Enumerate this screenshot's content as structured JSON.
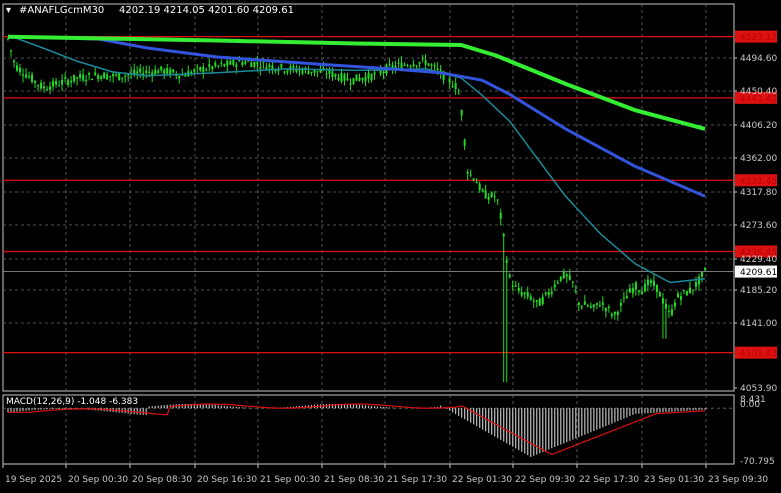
{
  "colors": {
    "background": "#000000",
    "grid": "#6b6b6b",
    "axis": "#c8c8c8",
    "candle": "#22dd22",
    "ma_slow": "#33ee33",
    "ma_mid": "#3355dd",
    "ma_fast": "#1a8a9a",
    "level_line": "#dd1111",
    "level_label_bg": "#dd1111",
    "level_label_text": "#bb0000",
    "current_label_bg": "#ffffff",
    "current_label_text": "#000000",
    "macd_hist": "#c0c0c0",
    "macd_signal": "#dd1111"
  },
  "header": {
    "symbol_info": "#ANAFLGcmM30",
    "ohlc": "4202.19 4214.05 4201.60 4209.61"
  },
  "chart_data": [
    {
      "type": "candlestick",
      "title": "",
      "y_ticks": [
        "4494.60",
        "4450.40",
        "4406.20",
        "4362.00",
        "4317.80",
        "4273.60",
        "4229.40",
        "4185.20",
        "4141.00",
        "4053.90"
      ],
      "x_ticks": [
        "19 Sep 2025",
        "20 Sep 00:30",
        "20 Sep 08:30",
        "20 Sep 16:30",
        "21 Sep 00:30",
        "21 Sep 08:30",
        "21 Sep 17:30",
        "22 Sep 01:30",
        "22 Sep 09:30",
        "22 Sep 17:30",
        "23 Sep 01:30",
        "23 Sep 09:30"
      ],
      "price_path": [
        [
          0,
          4520
        ],
        [
          0.01,
          4485
        ],
        [
          0.03,
          4470
        ],
        [
          0.05,
          4455
        ],
        [
          0.07,
          4460
        ],
        [
          0.1,
          4468
        ],
        [
          0.13,
          4472
        ],
        [
          0.16,
          4470
        ],
        [
          0.19,
          4475
        ],
        [
          0.22,
          4478
        ],
        [
          0.25,
          4472
        ],
        [
          0.28,
          4480
        ],
        [
          0.31,
          4485
        ],
        [
          0.34,
          4490
        ],
        [
          0.37,
          4485
        ],
        [
          0.4,
          4480
        ],
        [
          0.43,
          4478
        ],
        [
          0.46,
          4475
        ],
        [
          0.49,
          4465
        ],
        [
          0.52,
          4470
        ],
        [
          0.55,
          4482
        ],
        [
          0.58,
          4488
        ],
        [
          0.6,
          4490
        ],
        [
          0.62,
          4475
        ],
        [
          0.645,
          4455
        ],
        [
          0.65,
          4430
        ],
        [
          0.66,
          4340
        ],
        [
          0.67,
          4335
        ],
        [
          0.68,
          4315
        ],
        [
          0.69,
          4310
        ],
        [
          0.7,
          4310
        ],
        [
          0.705,
          4295
        ],
        [
          0.715,
          4230
        ],
        [
          0.72,
          4200
        ],
        [
          0.73,
          4185
        ],
        [
          0.74,
          4180
        ],
        [
          0.75,
          4175
        ],
        [
          0.76,
          4165
        ],
        [
          0.77,
          4175
        ],
        [
          0.78,
          4185
        ],
        [
          0.79,
          4200
        ],
        [
          0.8,
          4205
        ],
        [
          0.81,
          4195
        ],
        [
          0.82,
          4165
        ],
        [
          0.83,
          4165
        ],
        [
          0.84,
          4160
        ],
        [
          0.85,
          4168
        ],
        [
          0.86,
          4160
        ],
        [
          0.87,
          4150
        ],
        [
          0.88,
          4165
        ],
        [
          0.89,
          4180
        ],
        [
          0.9,
          4190
        ],
        [
          0.91,
          4185
        ],
        [
          0.92,
          4195
        ],
        [
          0.93,
          4190
        ],
        [
          0.94,
          4170
        ],
        [
          0.95,
          4150
        ],
        [
          0.96,
          4175
        ],
        [
          0.97,
          4180
        ],
        [
          0.98,
          4185
        ],
        [
          0.99,
          4195
        ],
        [
          1.0,
          4209.61
        ]
      ],
      "ma_slow": [
        [
          0,
          4523
        ],
        [
          0.3,
          4518
        ],
        [
          0.5,
          4514
        ],
        [
          0.65,
          4512
        ],
        [
          0.7,
          4498
        ],
        [
          0.8,
          4460
        ],
        [
          0.9,
          4425
        ],
        [
          1.0,
          4400
        ]
      ],
      "ma_mid": [
        [
          0,
          4523
        ],
        [
          0.13,
          4520
        ],
        [
          0.2,
          4508
        ],
        [
          0.3,
          4496
        ],
        [
          0.45,
          4486
        ],
        [
          0.55,
          4480
        ],
        [
          0.62,
          4475
        ],
        [
          0.68,
          4465
        ],
        [
          0.72,
          4446
        ],
        [
          0.8,
          4400
        ],
        [
          0.9,
          4350
        ],
        [
          1.0,
          4310
        ]
      ],
      "ma_fast": [
        [
          0,
          4525
        ],
        [
          0.05,
          4508
        ],
        [
          0.1,
          4490
        ],
        [
          0.15,
          4476
        ],
        [
          0.2,
          4471
        ],
        [
          0.3,
          4475
        ],
        [
          0.4,
          4480
        ],
        [
          0.5,
          4478
        ],
        [
          0.6,
          4480
        ],
        [
          0.65,
          4468
        ],
        [
          0.68,
          4445
        ],
        [
          0.72,
          4410
        ],
        [
          0.76,
          4360
        ],
        [
          0.8,
          4310
        ],
        [
          0.85,
          4260
        ],
        [
          0.9,
          4220
        ],
        [
          0.95,
          4195
        ],
        [
          1.0,
          4200
        ]
      ],
      "levels": [
        {
          "label": "4523.17",
          "value": 4523.17
        },
        {
          "label": "4441.42",
          "value": 4441.42
        },
        {
          "label": "4331.45",
          "value": 4331.45
        },
        {
          "label": "4236.45",
          "value": 4236.45
        },
        {
          "label": "4101.43",
          "value": 4101.43
        }
      ],
      "current_price": {
        "label": "4209.61",
        "value": 4209.61
      },
      "ylim": [
        4040,
        4560
      ]
    },
    {
      "type": "bar",
      "title": "MACD(12,26,9) -1.048 -6.383",
      "y_ticks": [
        "8.431",
        "0.00",
        "-70.795"
      ],
      "ylim": [
        -75,
        10
      ]
    }
  ]
}
